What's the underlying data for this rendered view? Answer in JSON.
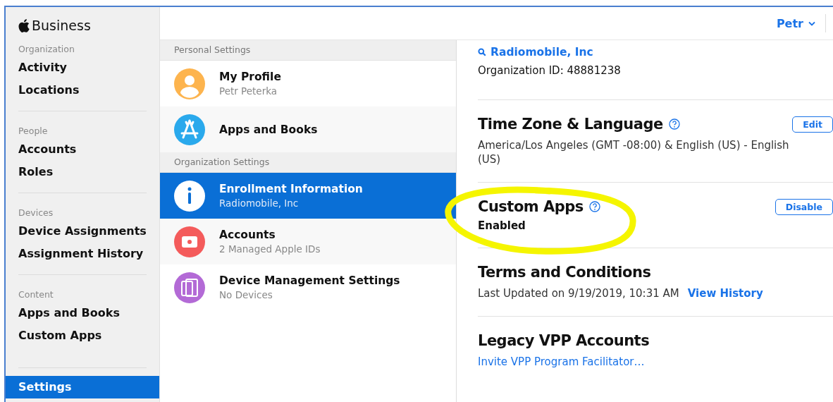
{
  "brand": {
    "name": "Business"
  },
  "account_menu": {
    "label": "Petr"
  },
  "sidebar": {
    "sections": [
      {
        "title": "Organization",
        "items": [
          {
            "label": "Activity",
            "selected": false
          },
          {
            "label": "Locations",
            "selected": false
          }
        ]
      },
      {
        "title": "People",
        "items": [
          {
            "label": "Accounts",
            "selected": false
          },
          {
            "label": "Roles",
            "selected": false
          }
        ]
      },
      {
        "title": "Devices",
        "items": [
          {
            "label": "Device Assignments",
            "selected": false
          },
          {
            "label": "Assignment History",
            "selected": false
          }
        ]
      },
      {
        "title": "Content",
        "items": [
          {
            "label": "Apps and Books",
            "selected": false
          },
          {
            "label": "Custom Apps",
            "selected": false
          }
        ]
      },
      {
        "items": [
          {
            "label": "Settings",
            "selected": true
          }
        ]
      }
    ]
  },
  "settings_list": {
    "groups": [
      {
        "title": "Personal Settings",
        "items": [
          {
            "kind": "profile",
            "title": "My Profile",
            "subtitle": "Petr Peterka",
            "selected": false
          },
          {
            "kind": "apps",
            "title": "Apps and Books",
            "selected": false
          }
        ]
      },
      {
        "title": "Organization Settings",
        "items": [
          {
            "kind": "info",
            "title": "Enrollment Information",
            "subtitle": "Radiomobile, Inc",
            "selected": true
          },
          {
            "kind": "accounts",
            "title": "Accounts",
            "subtitle": "2 Managed Apple IDs",
            "selected": false
          },
          {
            "kind": "devices",
            "title": "Device Management Settings",
            "subtitle": "No Devices",
            "selected": false
          }
        ]
      }
    ]
  },
  "detail": {
    "organization": {
      "name": "Radiomobile, Inc",
      "id_line": "Organization ID: 48881238"
    },
    "sections": [
      {
        "title": "Time Zone & Language",
        "help": true,
        "button": "Edit",
        "text": "America/Los Angeles (GMT -08:00) & English (US) - English (US)"
      },
      {
        "title": "Custom Apps",
        "help": true,
        "button": "Disable",
        "status": "Enabled",
        "highlighted": true
      },
      {
        "title": "Terms and Conditions",
        "text": "Last Updated on 9/19/2019, 10:31 AM",
        "link": "View History"
      },
      {
        "title": "Legacy VPP Accounts",
        "link": "Invite VPP Program Facilitator…"
      }
    ]
  }
}
